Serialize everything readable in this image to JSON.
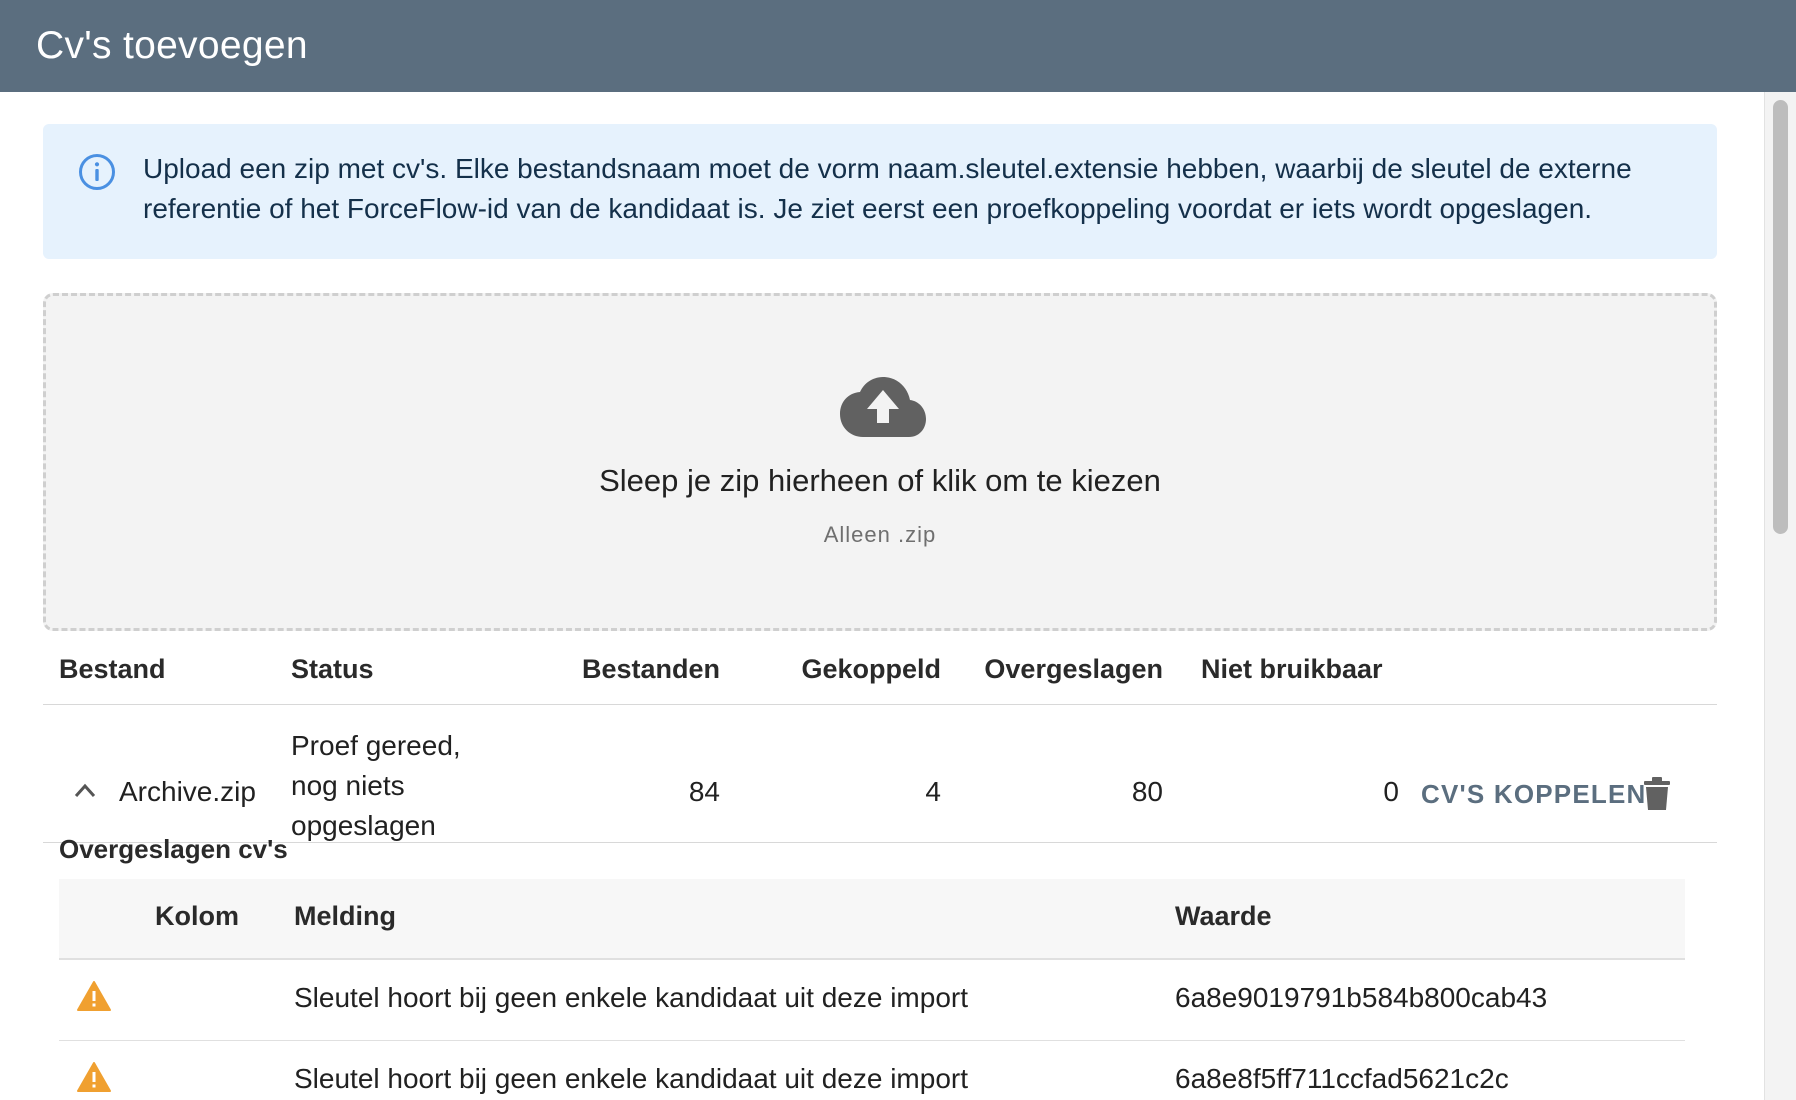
{
  "window": {
    "title": "Cv's toevoegen"
  },
  "alert": {
    "icon": "info-icon",
    "text": "Upload een zip met cv's. Elke bestandsnaam moet de vorm naam.sleutel.extensie hebben, waarbij de sleutel de externe referentie of het ForceFlow-id van de kandidaat is. Je ziet eerst een proefkoppeling voordat er iets wordt opgeslagen."
  },
  "dropzone": {
    "icon": "cloud-upload-icon",
    "title": "Sleep je zip hierheen of klik om te kiezen",
    "subtitle": "Alleen .zip"
  },
  "files_table": {
    "headers": {
      "file": "Bestand",
      "status": "Status",
      "files": "Bestanden",
      "linked": "Gekoppeld",
      "skipped": "Overgeslagen",
      "unusable": "Niet bruikbaar"
    },
    "rows": [
      {
        "file": "Archive.zip",
        "status_lines": [
          "Proef gereed,",
          "nog niets",
          "opgeslagen"
        ],
        "files": "84",
        "linked": "4",
        "skipped": "80",
        "unusable": "0",
        "action_label": "CV'S KOPPELEN",
        "expanded": true
      }
    ]
  },
  "skipped_section": {
    "title": "Overgeslagen cv's",
    "headers": {
      "column": "Kolom",
      "message": "Melding",
      "value": "Waarde"
    },
    "rows": [
      {
        "icon": "warning-icon",
        "column": "",
        "message": "Sleutel hoort bij geen enkele kandidaat uit deze import",
        "value": "6a8e9019791b584b800cab43"
      },
      {
        "icon": "warning-icon",
        "column": "",
        "message": "Sleutel hoort bij geen enkele kandidaat uit deze import",
        "value": "6a8e8f5ff711ccfad5621c2c"
      }
    ]
  },
  "colors": {
    "titlebar": "#5b6e7f",
    "alert_bg": "#e6f2fd",
    "info_icon": "#4a90e2",
    "warning": "#f0a030",
    "action": "#5b6e7f"
  }
}
